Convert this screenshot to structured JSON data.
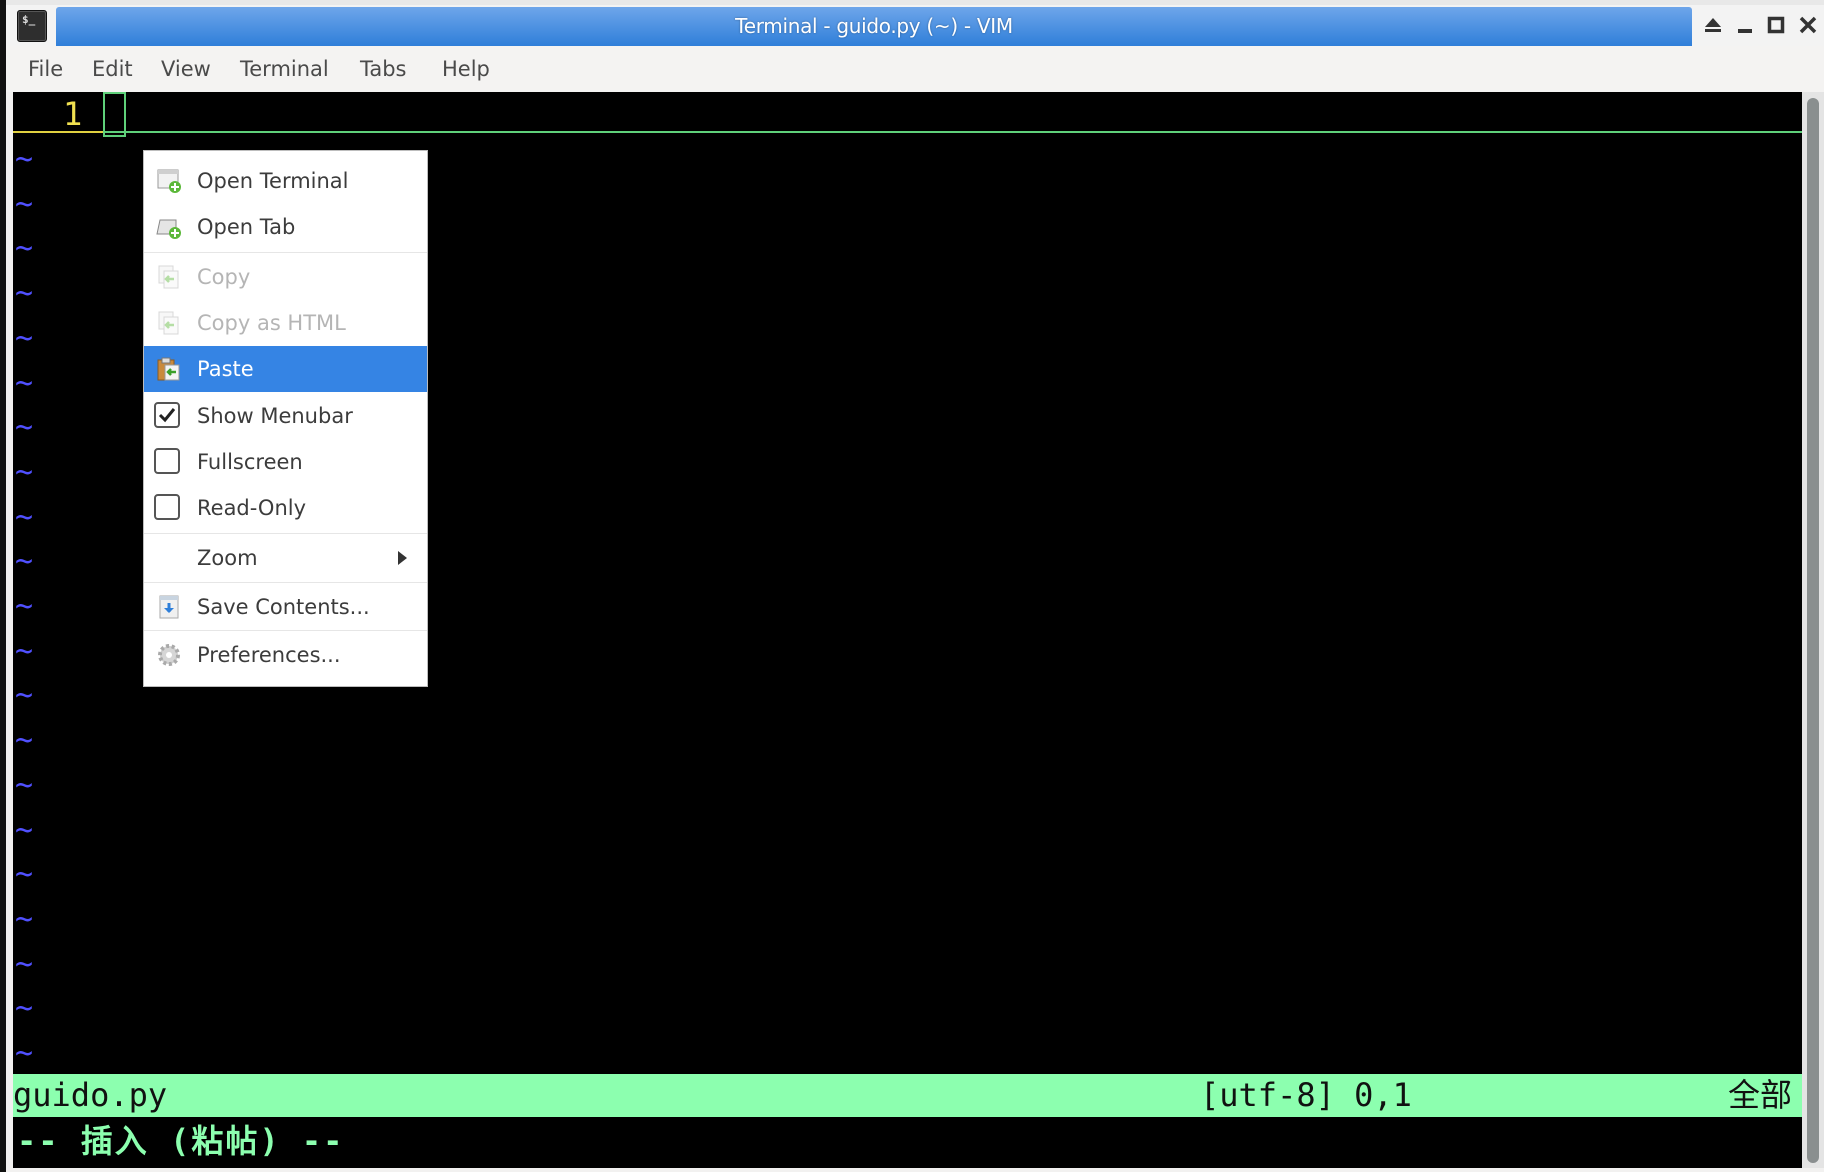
{
  "window": {
    "title": "Terminal - guido.py (~) - VIM",
    "app_icon": "terminal-icon",
    "app_icon_glyph": "$_",
    "controls": [
      {
        "name": "shade-button",
        "icon": "eject-icon"
      },
      {
        "name": "minimize-button",
        "icon": "minimize-icon"
      },
      {
        "name": "maximize-button",
        "icon": "maximize-icon"
      },
      {
        "name": "close-button",
        "icon": "close-icon"
      }
    ]
  },
  "menubar": {
    "items": [
      "File",
      "Edit",
      "View",
      "Terminal",
      "Tabs",
      "Help"
    ]
  },
  "editor": {
    "line_number": "1",
    "tilde": "~",
    "tilde_count": 21,
    "colors": {
      "line_number": "#f0e050",
      "cursorline": "#5fd07a",
      "tilde": "#5050ff",
      "status_bg": "#8cffaf"
    }
  },
  "statusline": {
    "filename": "guido.py",
    "encoding_position": "[utf-8] 0,1",
    "scroll": "全部"
  },
  "modeline": {
    "text": "-- 插入 (粘帖) --"
  },
  "context_menu": {
    "items": [
      {
        "label": "Open Terminal",
        "icon": "open-terminal-icon",
        "type": "normal"
      },
      {
        "label": "Open Tab",
        "icon": "open-tab-icon",
        "type": "normal"
      },
      {
        "label": "Copy",
        "icon": "copy-icon",
        "type": "disabled"
      },
      {
        "label": "Copy as HTML",
        "icon": "copy-html-icon",
        "type": "disabled"
      },
      {
        "label": "Paste",
        "icon": "paste-icon",
        "type": "active"
      },
      {
        "label": "Show Menubar",
        "type": "check",
        "checked": true
      },
      {
        "label": "Fullscreen",
        "type": "check",
        "checked": false
      },
      {
        "label": "Read-Only",
        "type": "check",
        "checked": false
      },
      {
        "label": "Zoom",
        "type": "submenu"
      },
      {
        "label": "Save Contents...",
        "icon": "save-icon",
        "type": "normal"
      },
      {
        "label": "Preferences...",
        "icon": "gear-icon",
        "type": "normal"
      }
    ],
    "accent": "#3584e4"
  }
}
